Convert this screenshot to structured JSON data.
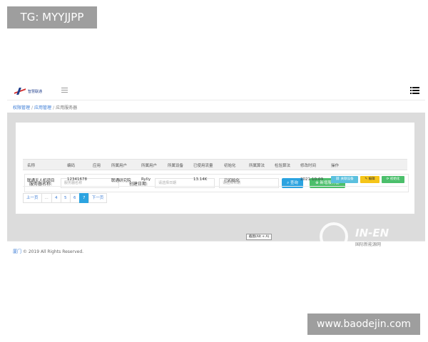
{
  "overlay": {
    "tg_label": "TG: MYYJJPP",
    "site_label": "www.baodejin.com"
  },
  "header": {
    "logo_text": "智慧联通"
  },
  "breadcrumb": {
    "items": [
      "权限管理",
      "应用管理",
      "应用服务器"
    ]
  },
  "filters": {
    "service_name_label": "服务器名称:",
    "service_name_placeholder": "服务器名称",
    "created_date_label": "创建日期:",
    "start_date_placeholder": "请选择日期",
    "end_date_placeholder": "请选择日期",
    "query_label": "查询",
    "add_label": "新增服务器"
  },
  "table": {
    "headers": [
      "名称",
      "编码",
      "应用",
      "所属用户",
      "所属用户",
      "所属设备",
      "已使用流量",
      "初始化",
      "所属算法",
      "检验算法",
      "修改时间",
      "操作"
    ],
    "rows": [
      {
        "name": "联通无人机项目",
        "code": "12341678",
        "app": "",
        "owner": "联通研究院",
        "user": "Rylly",
        "device": "",
        "traffic": "13.14K",
        "init": "已初始化",
        "algo": "",
        "check": "",
        "modified": "2021-10-03",
        "actions": {
          "info": "关联设备",
          "edit": "编辑",
          "init": "初始化"
        }
      }
    ]
  },
  "pagination": {
    "prev": "上一页",
    "ellipsis": "...",
    "pages": [
      "4",
      "5",
      "6",
      "7"
    ],
    "current": "7",
    "next": "下一页"
  },
  "footer": {
    "brand": "厦门",
    "copyright": "© 2019 All Rights Reserved."
  },
  "tooltip": {
    "text": "截图(Alt + A)"
  },
  "watermark": {
    "line1": "IN-EN",
    "line2": "国际新能源网"
  }
}
